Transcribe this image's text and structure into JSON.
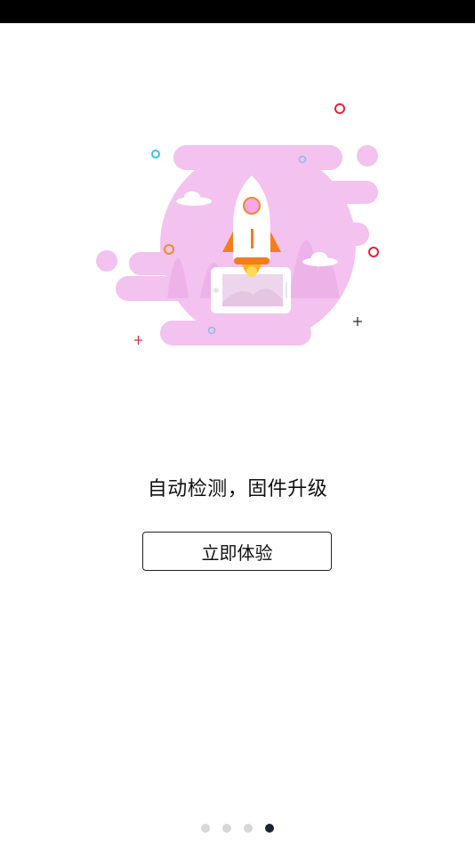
{
  "status_bar": {},
  "illustration": {
    "icon": "rocket-launch-illustration",
    "colors": {
      "blob": "#f3c2ef",
      "rocket_body": "#ffffff",
      "flame": "#ff8c00",
      "accent_red": "#e0233a",
      "accent_cyan": "#36c7e0",
      "accent_orange": "#f08a2c"
    }
  },
  "content": {
    "tagline": "自动检测，固件升级",
    "cta_label": "立即体验"
  },
  "pager": {
    "total": 4,
    "active_index": 3
  }
}
